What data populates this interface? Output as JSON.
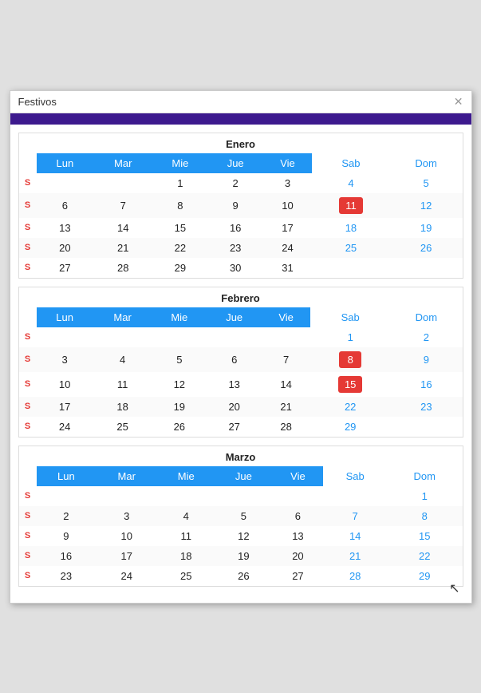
{
  "dialog": {
    "title": "Festivos",
    "close_label": "✕"
  },
  "months": [
    {
      "name": "Enero",
      "headers": [
        "Lun",
        "Mar",
        "Mie",
        "Jue",
        "Vie",
        "Sab",
        "Dom"
      ],
      "rows": [
        [
          "",
          "",
          "",
          "1",
          "2",
          "3",
          "4",
          "5"
        ],
        [
          "",
          "6",
          "7",
          "8",
          "9",
          "10",
          "11",
          "12"
        ],
        [
          "",
          "13",
          "14",
          "15",
          "16",
          "17",
          "18",
          "19"
        ],
        [
          "",
          "20",
          "21",
          "22",
          "23",
          "24",
          "25",
          "26"
        ],
        [
          "",
          "27",
          "28",
          "29",
          "30",
          "31",
          "",
          ""
        ]
      ],
      "holidays": [
        "11"
      ]
    },
    {
      "name": "Febrero",
      "headers": [
        "Lun",
        "Mar",
        "Mie",
        "Jue",
        "Vie",
        "Sab",
        "Dom"
      ],
      "rows": [
        [
          "",
          "",
          "",
          "",
          "",
          "",
          "1",
          "2"
        ],
        [
          "",
          "3",
          "4",
          "5",
          "6",
          "7",
          "8",
          "9"
        ],
        [
          "",
          "10",
          "11",
          "12",
          "13",
          "14",
          "15",
          "16"
        ],
        [
          "",
          "17",
          "18",
          "19",
          "20",
          "21",
          "22",
          "23"
        ],
        [
          "",
          "24",
          "25",
          "26",
          "27",
          "28",
          "29",
          ""
        ]
      ],
      "holidays": [
        "8",
        "15"
      ]
    },
    {
      "name": "Marzo",
      "headers": [
        "Lun",
        "Mar",
        "Mie",
        "Jue",
        "Vie",
        "Sab",
        "Dom"
      ],
      "rows": [
        [
          "",
          "",
          "",
          "",
          "",
          "",
          "",
          "1"
        ],
        [
          "",
          "2",
          "3",
          "4",
          "5",
          "6",
          "7",
          "8"
        ],
        [
          "",
          "9",
          "10",
          "11",
          "12",
          "13",
          "14",
          "15"
        ],
        [
          "",
          "16",
          "17",
          "18",
          "19",
          "20",
          "21",
          "22"
        ],
        [
          "",
          "23",
          "24",
          "25",
          "26",
          "27",
          "28",
          "29"
        ]
      ],
      "holidays": []
    }
  ]
}
